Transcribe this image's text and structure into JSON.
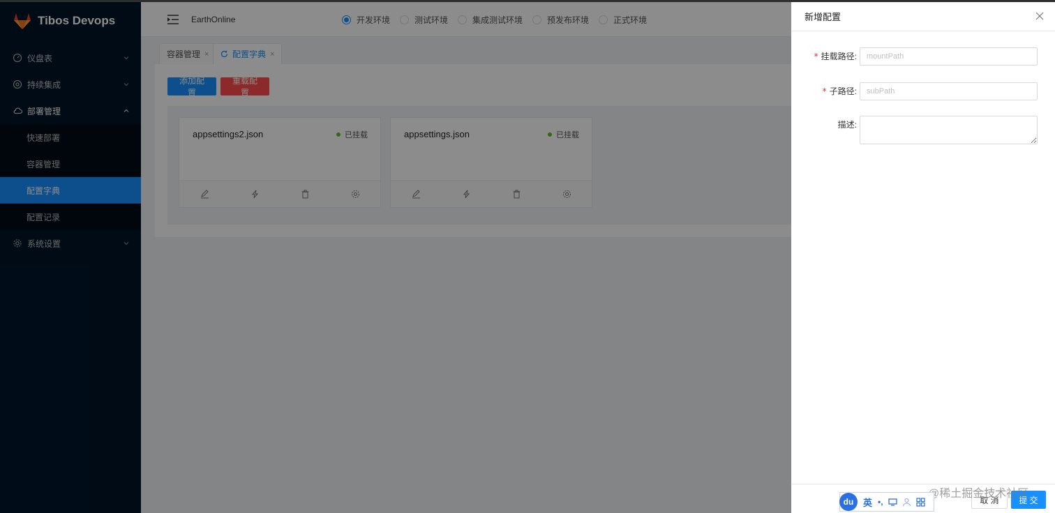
{
  "brand": {
    "name": "Tibos Devops"
  },
  "sidebar": {
    "items": [
      {
        "label": "仪盘表"
      },
      {
        "label": "持续集成"
      },
      {
        "label": "部署管理"
      },
      {
        "label": "系统设置"
      }
    ],
    "deploy_sub": [
      {
        "label": "快速部署"
      },
      {
        "label": "容器管理"
      },
      {
        "label": "配置字典"
      },
      {
        "label": "配置记录"
      }
    ]
  },
  "header": {
    "project": "EarthOnline",
    "envs": [
      {
        "label": "开发环境",
        "checked": true
      },
      {
        "label": "测试环境"
      },
      {
        "label": "集成测试环境"
      },
      {
        "label": "预发布环境"
      },
      {
        "label": "正式环境"
      }
    ]
  },
  "tabs": [
    {
      "label": "容器管理",
      "close": "×"
    },
    {
      "label": "配置字典",
      "close": "×"
    }
  ],
  "toolbar": {
    "add_label": "添加配置",
    "reload_label": "重载配置"
  },
  "cards": [
    {
      "title": "appsettings2.json",
      "status": "已挂载"
    },
    {
      "title": "appsettings.json",
      "status": "已挂载"
    }
  ],
  "drawer": {
    "title": "新增配置",
    "fields": {
      "mount_label": "挂载路径:",
      "mount_placeholder": "mountPath",
      "sub_label": "子路径:",
      "sub_placeholder": "subPath",
      "desc_label": "描述:"
    },
    "required_mark": "*",
    "cancel_label": "取 消",
    "submit_label": "提 交"
  },
  "ime": {
    "logo": "du",
    "lang": "英",
    "punct": "•,",
    "icons": [
      "keyboard-icon",
      "user-icon",
      "grid-icon"
    ]
  },
  "watermark": "@稀土掘金技术社区",
  "colors": {
    "sidebar_bg": "#001529",
    "primary": "#1890ff",
    "danger": "#ff4d4f",
    "success": "#52c41a"
  }
}
